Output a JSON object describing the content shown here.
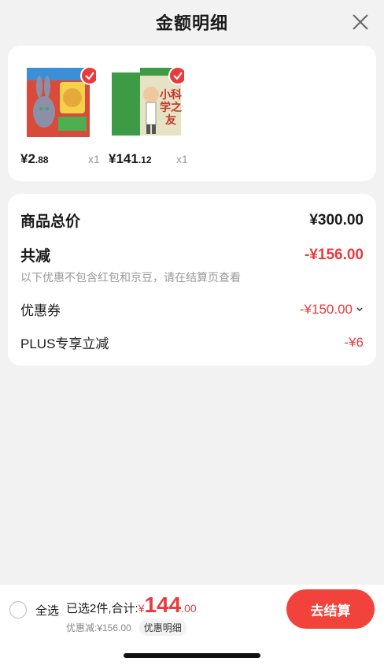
{
  "header": {
    "title": "金额明细"
  },
  "products": [
    {
      "price_main": "¥2",
      "price_dec": ".88",
      "qty": "x1",
      "icon": "zootopia-book-cover"
    },
    {
      "price_main": "¥141",
      "price_dec": ".12",
      "qty": "x1",
      "icon": "science-book-cover",
      "cover_text": "小科学之友"
    }
  ],
  "summary": {
    "total_label": "商品总价",
    "total_value": "¥300.00",
    "discount_label": "共减",
    "discount_value": "-¥156.00",
    "note": "以下优惠不包含红包和京豆，请在结算页查看",
    "coupon_label": "优惠券",
    "coupon_value": "-¥150.00",
    "plus_label": "PLUS专享立减",
    "plus_value": "-¥6"
  },
  "footer": {
    "select_all": "全选",
    "selected_text": "已选2件,合计:",
    "yen": "¥",
    "amount_int": "144",
    "amount_dec": ".00",
    "discount_text": "优惠减:¥156.00",
    "detail_tag": "优惠明细",
    "checkout_label": "去结算"
  },
  "colors": {
    "accent": "#e93b3d",
    "button": "#f1423c"
  }
}
